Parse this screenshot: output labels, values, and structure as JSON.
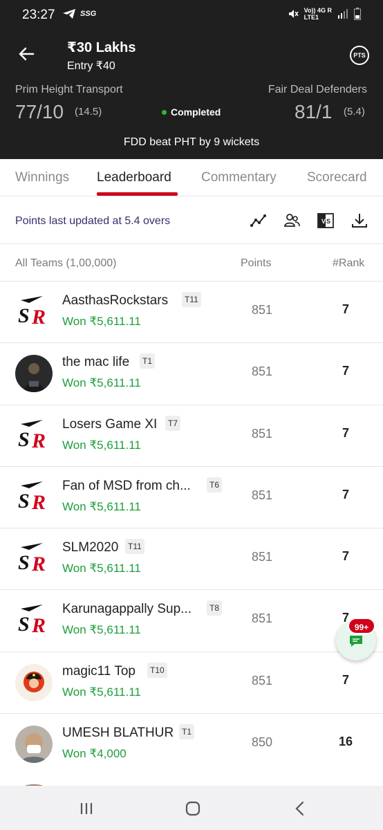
{
  "status_bar": {
    "time": "23:27",
    "carrier_tag": "SSG",
    "network_top": "Vo)) 4G R",
    "network_bottom": "LTE1"
  },
  "header": {
    "contest_title": "₹30 Lakhs",
    "entry": "Entry ₹40",
    "pts_label": "PTS",
    "team_left": {
      "name": "Prim Height Transport",
      "score": "77/10",
      "overs": "(14.5)"
    },
    "team_right": {
      "name": "Fair Deal Defenders",
      "score": "81/1",
      "overs": "(5.4)"
    },
    "match_status": "Completed",
    "result": "FDD beat PHT by 9 wickets"
  },
  "tabs": [
    {
      "label": "Winnings",
      "active": false
    },
    {
      "label": "Leaderboard",
      "active": true
    },
    {
      "label": "Commentary",
      "active": false
    },
    {
      "label": "Scorecard",
      "active": false
    }
  ],
  "toolbar": {
    "updated_text": "Points last updated at 5.4 overs",
    "icons": [
      "trend-icon",
      "compare-users-icon",
      "vs-icon",
      "download-icon"
    ]
  },
  "columns": {
    "teams": "All Teams (1,00,000)",
    "points": "Points",
    "rank": "#Rank"
  },
  "rows": [
    {
      "name": "AasthasRockstars",
      "team": "T11",
      "won": "Won ₹5,611.11",
      "points": "851",
      "rank": "7",
      "avatar": "sr-logo"
    },
    {
      "name": "the mac life",
      "team": "T1",
      "won": "Won ₹5,611.11",
      "points": "851",
      "rank": "7",
      "avatar": "photo-dark"
    },
    {
      "name": "Losers Game XI",
      "team": "T7",
      "won": "Won ₹5,611.11",
      "points": "851",
      "rank": "7",
      "avatar": "sr-logo"
    },
    {
      "name": "Fan of MSD from ch...",
      "team": "T6",
      "won": "Won ₹5,611.11",
      "points": "851",
      "rank": "7",
      "avatar": "sr-logo"
    },
    {
      "name": "SLM2020",
      "team": "T11",
      "won": "Won ₹5,611.11",
      "points": "851",
      "rank": "7",
      "avatar": "sr-logo"
    },
    {
      "name": "Karunagappally Sup...",
      "team": "T8",
      "won": "Won ₹5,611.11",
      "points": "851",
      "rank": "7",
      "avatar": "sr-logo"
    },
    {
      "name": "magic11 Top",
      "team": "T10",
      "won": "Won ₹5,611.11",
      "points": "851",
      "rank": "7",
      "avatar": "photo-red"
    },
    {
      "name": "UMESH BLATHUR",
      "team": "T1",
      "won": "Won ₹4,000",
      "points": "850",
      "rank": "16",
      "avatar": "photo-person"
    }
  ],
  "chat": {
    "badge": "99+"
  },
  "colors": {
    "header_bg": "#1f1f1f",
    "accent_red": "#d0021b",
    "won_green": "#1e9e3a",
    "completed_dot": "#2eb82e"
  }
}
